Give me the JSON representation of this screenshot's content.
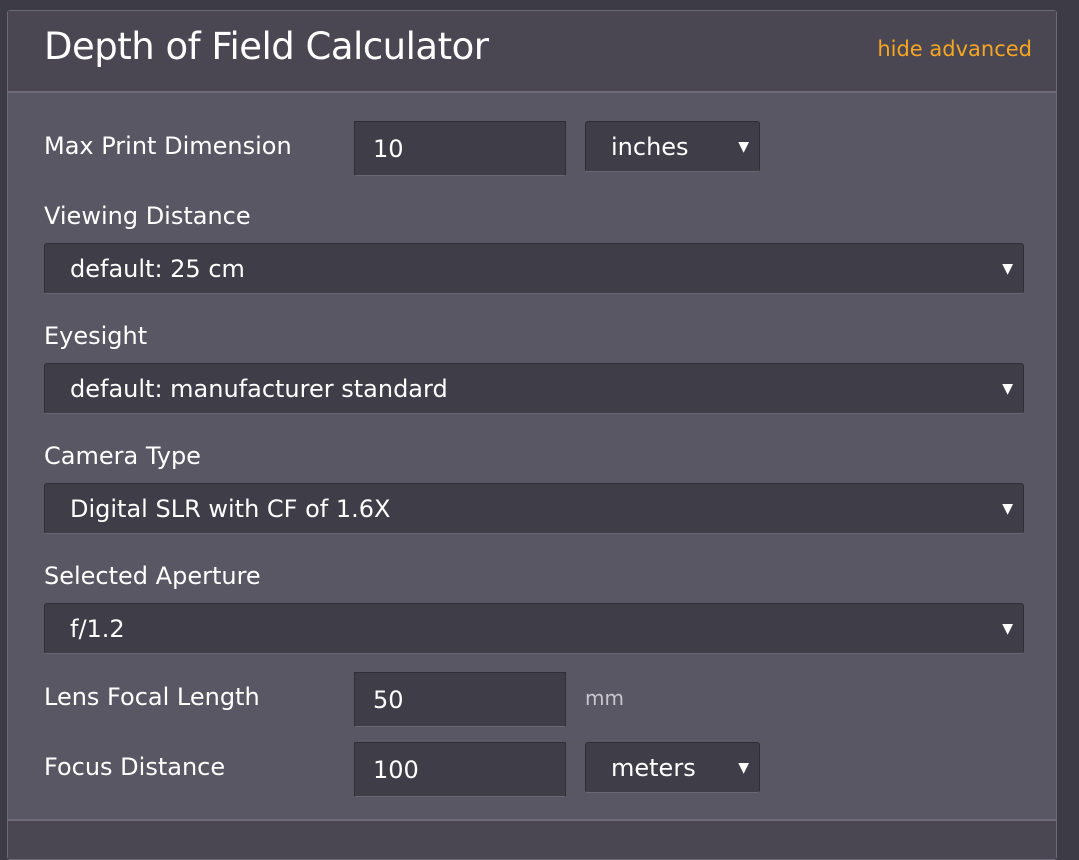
{
  "header": {
    "title": "Depth of Field Calculator",
    "toggle_link": "hide advanced"
  },
  "fields": {
    "max_print": {
      "label": "Max Print Dimension",
      "value": "10",
      "unit": "inches"
    },
    "viewing_distance": {
      "label": "Viewing Distance",
      "selected": "default: 25 cm"
    },
    "eyesight": {
      "label": "Eyesight",
      "selected": "default: manufacturer standard"
    },
    "camera_type": {
      "label": "Camera Type",
      "selected": "Digital SLR with CF of 1.6X"
    },
    "aperture": {
      "label": "Selected Aperture",
      "selected": "f/1.2"
    },
    "focal_length": {
      "label": "Lens Focal Length",
      "value": "50",
      "unit": "mm"
    },
    "focus_distance": {
      "label": "Focus Distance",
      "value": "100",
      "unit": "meters"
    }
  },
  "colors": {
    "accent": "#f5a623",
    "panel": "#5a5764",
    "header": "#4a4752",
    "field": "#3f3d47"
  },
  "icons": {
    "select_caret": "caret-down-icon"
  }
}
